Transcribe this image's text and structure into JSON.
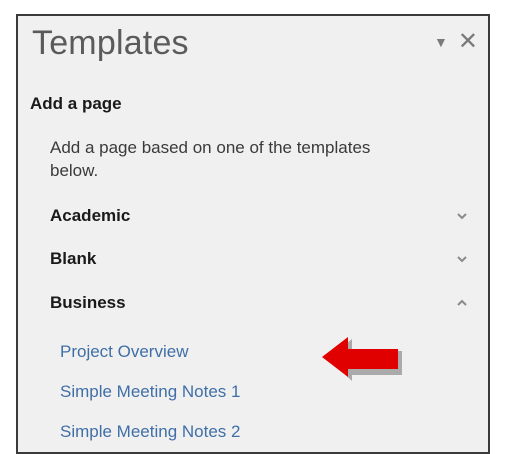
{
  "top_sliver_text": "~ ~ ~ ~ ~ ~ ~ ~ ~ ~",
  "pane": {
    "title": "Templates",
    "section_heading": "Add a page",
    "description": "Add a page based on one of the templates below.",
    "categories": [
      {
        "label": "Academic",
        "state": "collapsed"
      },
      {
        "label": "Blank",
        "state": "collapsed"
      },
      {
        "label": "Business",
        "state": "expanded"
      }
    ],
    "templates": [
      "Project Overview",
      "Simple Meeting Notes 1",
      "Simple Meeting Notes 2"
    ]
  },
  "icons": {
    "dropdown": "dropdown-icon",
    "close": "close-icon",
    "chevron_down": "chevron-down-icon",
    "chevron_up": "chevron-up-icon",
    "callout_arrow": "arrow-icon"
  },
  "colors": {
    "pane_background": "#f0f0f0",
    "title_text": "#5b5b5b",
    "link_text": "#3f6fa6",
    "callout_arrow": "#e00000"
  }
}
